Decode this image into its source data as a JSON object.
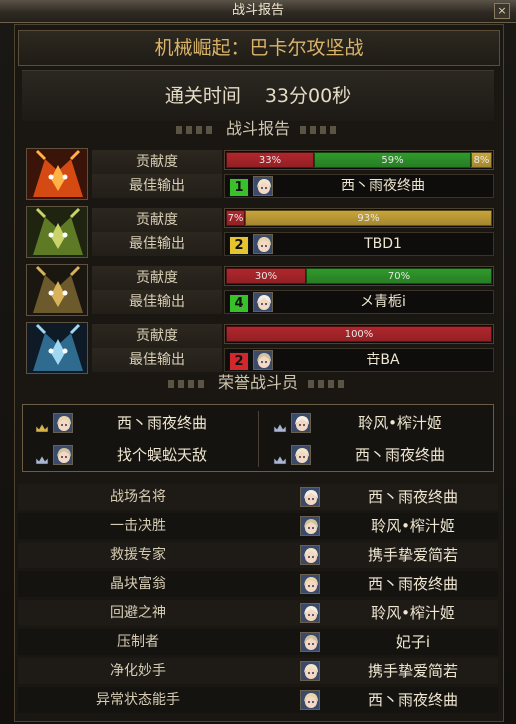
{
  "window": {
    "title": "战斗报告",
    "close_label": "×"
  },
  "mission": {
    "name": "机械崛起：巴卡尔攻坚战"
  },
  "clear_time": {
    "label": "通关时间",
    "value": "33分00秒"
  },
  "battle_report": {
    "title": "战斗报告",
    "contribution_label": "贡献度",
    "best_dps_label": "最佳输出",
    "bosses": [
      {
        "icon": "fire-dragon-icon",
        "segments": [
          {
            "percent": 33,
            "label": "33%",
            "color": "#b2262c"
          },
          {
            "percent": 59,
            "label": "59%",
            "color": "#2f9a2b"
          },
          {
            "percent": 8,
            "label": "8%",
            "color": "#c9a53a"
          }
        ],
        "best_rank": "1",
        "rank_color": "#39c12c",
        "best_name": "西丶雨夜终曲"
      },
      {
        "icon": "earth-dragon-icon",
        "segments": [
          {
            "percent": 7,
            "label": "7%",
            "color": "#b2262c"
          },
          {
            "percent": 93,
            "label": "93%",
            "color": "#c9a53a"
          }
        ],
        "best_rank": "2",
        "rank_color": "#e6c42e",
        "best_name": "TBD1"
      },
      {
        "icon": "dark-dragon-icon",
        "segments": [
          {
            "percent": 30,
            "label": "30%",
            "color": "#b2262c"
          },
          {
            "percent": 70,
            "label": "70%",
            "color": "#2f9a2b"
          }
        ],
        "best_rank": "4",
        "rank_color": "#39c12c",
        "best_name": "メ青栀i"
      },
      {
        "icon": "ice-dragon-icon",
        "segments": [
          {
            "percent": 100,
            "label": "100%",
            "color": "#b2262c"
          }
        ],
        "best_rank": "2",
        "rank_color": "#d2282c",
        "best_name": "卋BA"
      }
    ]
  },
  "honor": {
    "title": "荣誉战斗员",
    "members": [
      {
        "crown": "gold",
        "name": "西丶雨夜终曲"
      },
      {
        "crown": "silver",
        "name": "聆风•榨汁姬"
      },
      {
        "crown": "silver",
        "name": "找个蜈蚣天敌"
      },
      {
        "crown": "silver",
        "name": "西丶雨夜终曲"
      }
    ]
  },
  "awards": [
    {
      "title": "战场名将",
      "name": "西丶雨夜终曲"
    },
    {
      "title": "一击决胜",
      "name": "聆风•榨汁姬"
    },
    {
      "title": "救援专家",
      "name": "携手挚爱简若"
    },
    {
      "title": "晶块富翁",
      "name": "西丶雨夜终曲"
    },
    {
      "title": "回避之神",
      "name": "聆风•榨汁姬"
    },
    {
      "title": "压制者",
      "name": "妃子i"
    },
    {
      "title": "净化妙手",
      "name": "携手挚爱简若"
    },
    {
      "title": "异常状态能手",
      "name": "西丶雨夜终曲"
    }
  ]
}
